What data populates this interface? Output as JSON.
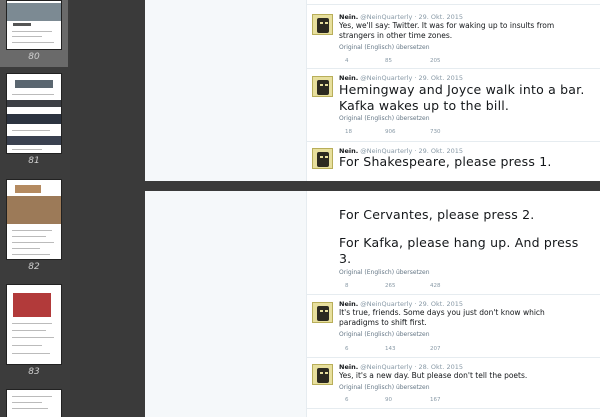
{
  "thumbnails": [
    {
      "page": "80",
      "selected": true
    },
    {
      "page": "81",
      "selected": false
    },
    {
      "page": "82",
      "selected": false
    },
    {
      "page": "83",
      "selected": false
    }
  ],
  "page_top": {
    "tweets": [
      {
        "name": "Nein.",
        "meta": "@NeinQuarterly · 29. Okt. 2015",
        "text": "Yes, we'll say: Twitter. It was for waking up to insults from strangers in other time zones.",
        "original": "Original (Englisch) übersetzen",
        "stats": [
          "4",
          "85",
          "205"
        ]
      },
      {
        "name": "Nein.",
        "meta": "@NeinQuarterly · 29. Okt. 2015",
        "text": "Hemingway and Joyce walk into a bar. Kafka wakes up to the bill.",
        "original": "Original (Englisch) übersetzen",
        "stats": [
          "18",
          "906",
          "730"
        ]
      },
      {
        "name": "Nein.",
        "meta": "@NeinQuarterly · 29. Okt. 2015",
        "text": "For Shakespeare, please press 1."
      }
    ]
  },
  "page_bottom": {
    "continuation": {
      "line1": "For Cervantes, please press 2.",
      "line2": "For Kafka, please hang up. And press 3.",
      "original": "Original (Englisch) übersetzen",
      "stats": [
        "8",
        "265",
        "428"
      ]
    },
    "tweets": [
      {
        "name": "Nein.",
        "meta": "@NeinQuarterly · 29. Okt. 2015",
        "text": "It's true, friends. Some days you just don't know which paradigms to shift first.",
        "original": "Original (Englisch) übersetzen",
        "stats": [
          "6",
          "143",
          "207"
        ]
      },
      {
        "name": "Nein.",
        "meta": "@NeinQuarterly · 28. Okt. 2015",
        "text": "Yes, it's a new day. But please don't tell the poets.",
        "original": "Original (Englisch) übersetzen",
        "stats": [
          "6",
          "90",
          "167"
        ]
      }
    ]
  }
}
